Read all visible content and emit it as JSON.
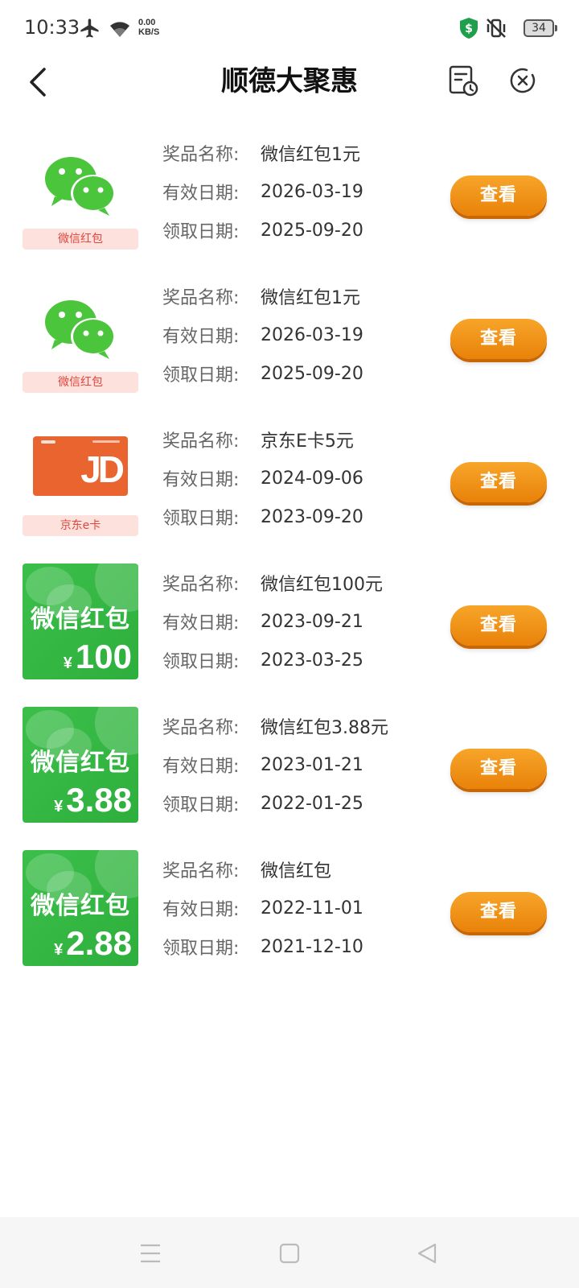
{
  "status_bar": {
    "time": "10:33",
    "net_speed_value": "0.00",
    "net_speed_unit": "KB/S",
    "battery": "34",
    "icons": [
      "airplane-icon",
      "wifi-icon",
      "shield-dollar-icon",
      "mute-vibrate-icon",
      "battery-icon"
    ]
  },
  "header": {
    "title": "顺德大聚惠",
    "icons": [
      "back-chevron-icon",
      "record-history-icon",
      "close-circle-icon"
    ]
  },
  "labels": {
    "prize_name": "奖品名称:",
    "valid_date": "有效日期:",
    "receive_date": "领取日期:",
    "view_button": "查看"
  },
  "prizes": [
    {
      "image_type": "wechat",
      "image_label": "微信红包",
      "name": "微信红包1元",
      "valid": "2026-03-19",
      "received": "2025-09-20"
    },
    {
      "image_type": "wechat",
      "image_label": "微信红包",
      "name": "微信红包1元",
      "valid": "2026-03-19",
      "received": "2025-09-20"
    },
    {
      "image_type": "jd",
      "image_label": "京东e卡",
      "image_logo": "JD",
      "name": "京东E卡5元",
      "valid": "2024-09-06",
      "received": "2023-09-20"
    },
    {
      "image_type": "hongbao",
      "image_title": "微信红包",
      "image_currency": "¥",
      "image_amount": "100",
      "name": "微信红包100元",
      "valid": "2023-09-21",
      "received": "2023-03-25"
    },
    {
      "image_type": "hongbao",
      "image_title": "微信红包",
      "image_currency": "¥",
      "image_amount": "3.88",
      "name": "微信红包3.88元",
      "valid": "2023-01-21",
      "received": "2022-01-25"
    },
    {
      "image_type": "hongbao",
      "image_title": "微信红包",
      "image_currency": "¥",
      "image_amount": "2.88",
      "name": "微信红包",
      "valid": "2022-11-01",
      "received": "2021-12-10"
    }
  ],
  "nav_bar": {
    "icons": [
      "menu-icon",
      "home-square-icon",
      "back-triangle-icon"
    ]
  },
  "colors": {
    "accent_orange": "#ef8c12",
    "wechat_green": "#3cbf4a",
    "label_red": "#e2463c"
  }
}
